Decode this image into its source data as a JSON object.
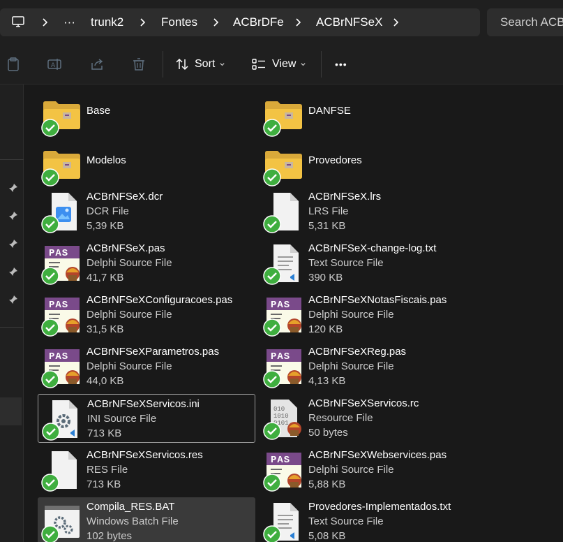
{
  "breadcrumb": {
    "overflow_label": "···",
    "items": [
      "trunk2",
      "Fontes",
      "ACBrDFe",
      "ACBrNFSeX"
    ]
  },
  "search": {
    "placeholder": "Search ACBrNFSeX"
  },
  "toolbar": {
    "sort_label": "Sort",
    "view_label": "View",
    "more_label": "•••"
  },
  "files": [
    {
      "name": "Base",
      "type": "",
      "size": "",
      "icon": "folder-icon"
    },
    {
      "name": "DANFSE",
      "type": "",
      "size": "",
      "icon": "folder-icon"
    },
    {
      "name": "Modelos",
      "type": "",
      "size": "",
      "icon": "folder-icon"
    },
    {
      "name": "Provedores",
      "type": "",
      "size": "",
      "icon": "folder-icon"
    },
    {
      "name": "ACBrNFSeX.dcr",
      "type": "DCR File",
      "size": "5,39 KB",
      "icon": "image-file-icon"
    },
    {
      "name": "ACBrNFSeX.lrs",
      "type": "LRS File",
      "size": "5,31 KB",
      "icon": "blank-file-icon"
    },
    {
      "name": "ACBrNFSeX.pas",
      "type": "Delphi Source File",
      "size": "41,7 KB",
      "icon": "delphi-pas-icon"
    },
    {
      "name": "ACBrNFSeX-change-log.txt",
      "type": "Text Source File",
      "size": "390 KB",
      "icon": "text-file-icon"
    },
    {
      "name": "ACBrNFSeXConfiguracoes.pas",
      "type": "Delphi Source File",
      "size": "31,5 KB",
      "icon": "delphi-pas-icon"
    },
    {
      "name": "ACBrNFSeXNotasFiscais.pas",
      "type": "Delphi Source File",
      "size": "120 KB",
      "icon": "delphi-pas-icon"
    },
    {
      "name": "ACBrNFSeXParametros.pas",
      "type": "Delphi Source File",
      "size": "44,0 KB",
      "icon": "delphi-pas-icon"
    },
    {
      "name": "ACBrNFSeXReg.pas",
      "type": "Delphi Source File",
      "size": "4,13 KB",
      "icon": "delphi-pas-icon"
    },
    {
      "name": "ACBrNFSeXServicos.ini",
      "type": "INI Source File",
      "size": "713 KB",
      "icon": "ini-file-icon"
    },
    {
      "name": "ACBrNFSeXServicos.rc",
      "type": "Resource File",
      "size": "50 bytes",
      "icon": "resource-file-icon"
    },
    {
      "name": "ACBrNFSeXServicos.res",
      "type": "RES File",
      "size": "713 KB",
      "icon": "blank-file-icon"
    },
    {
      "name": "ACBrNFSeXWebservices.pas",
      "type": "Delphi Source File",
      "size": "5,88 KB",
      "icon": "delphi-pas-icon"
    },
    {
      "name": "Compila_RES.BAT",
      "type": "Windows Batch File",
      "size": "102 bytes",
      "icon": "batch-file-icon"
    },
    {
      "name": "Provedores-Implementados.txt",
      "type": "Text Source File",
      "size": "5,08 KB",
      "icon": "text-file-icon"
    }
  ],
  "colors": {
    "background": "#191919",
    "sync_check": "#3fae3f",
    "folder": "#f3c344",
    "pas_banner": "#7a4a8a",
    "selected": "#3a3a3a"
  }
}
